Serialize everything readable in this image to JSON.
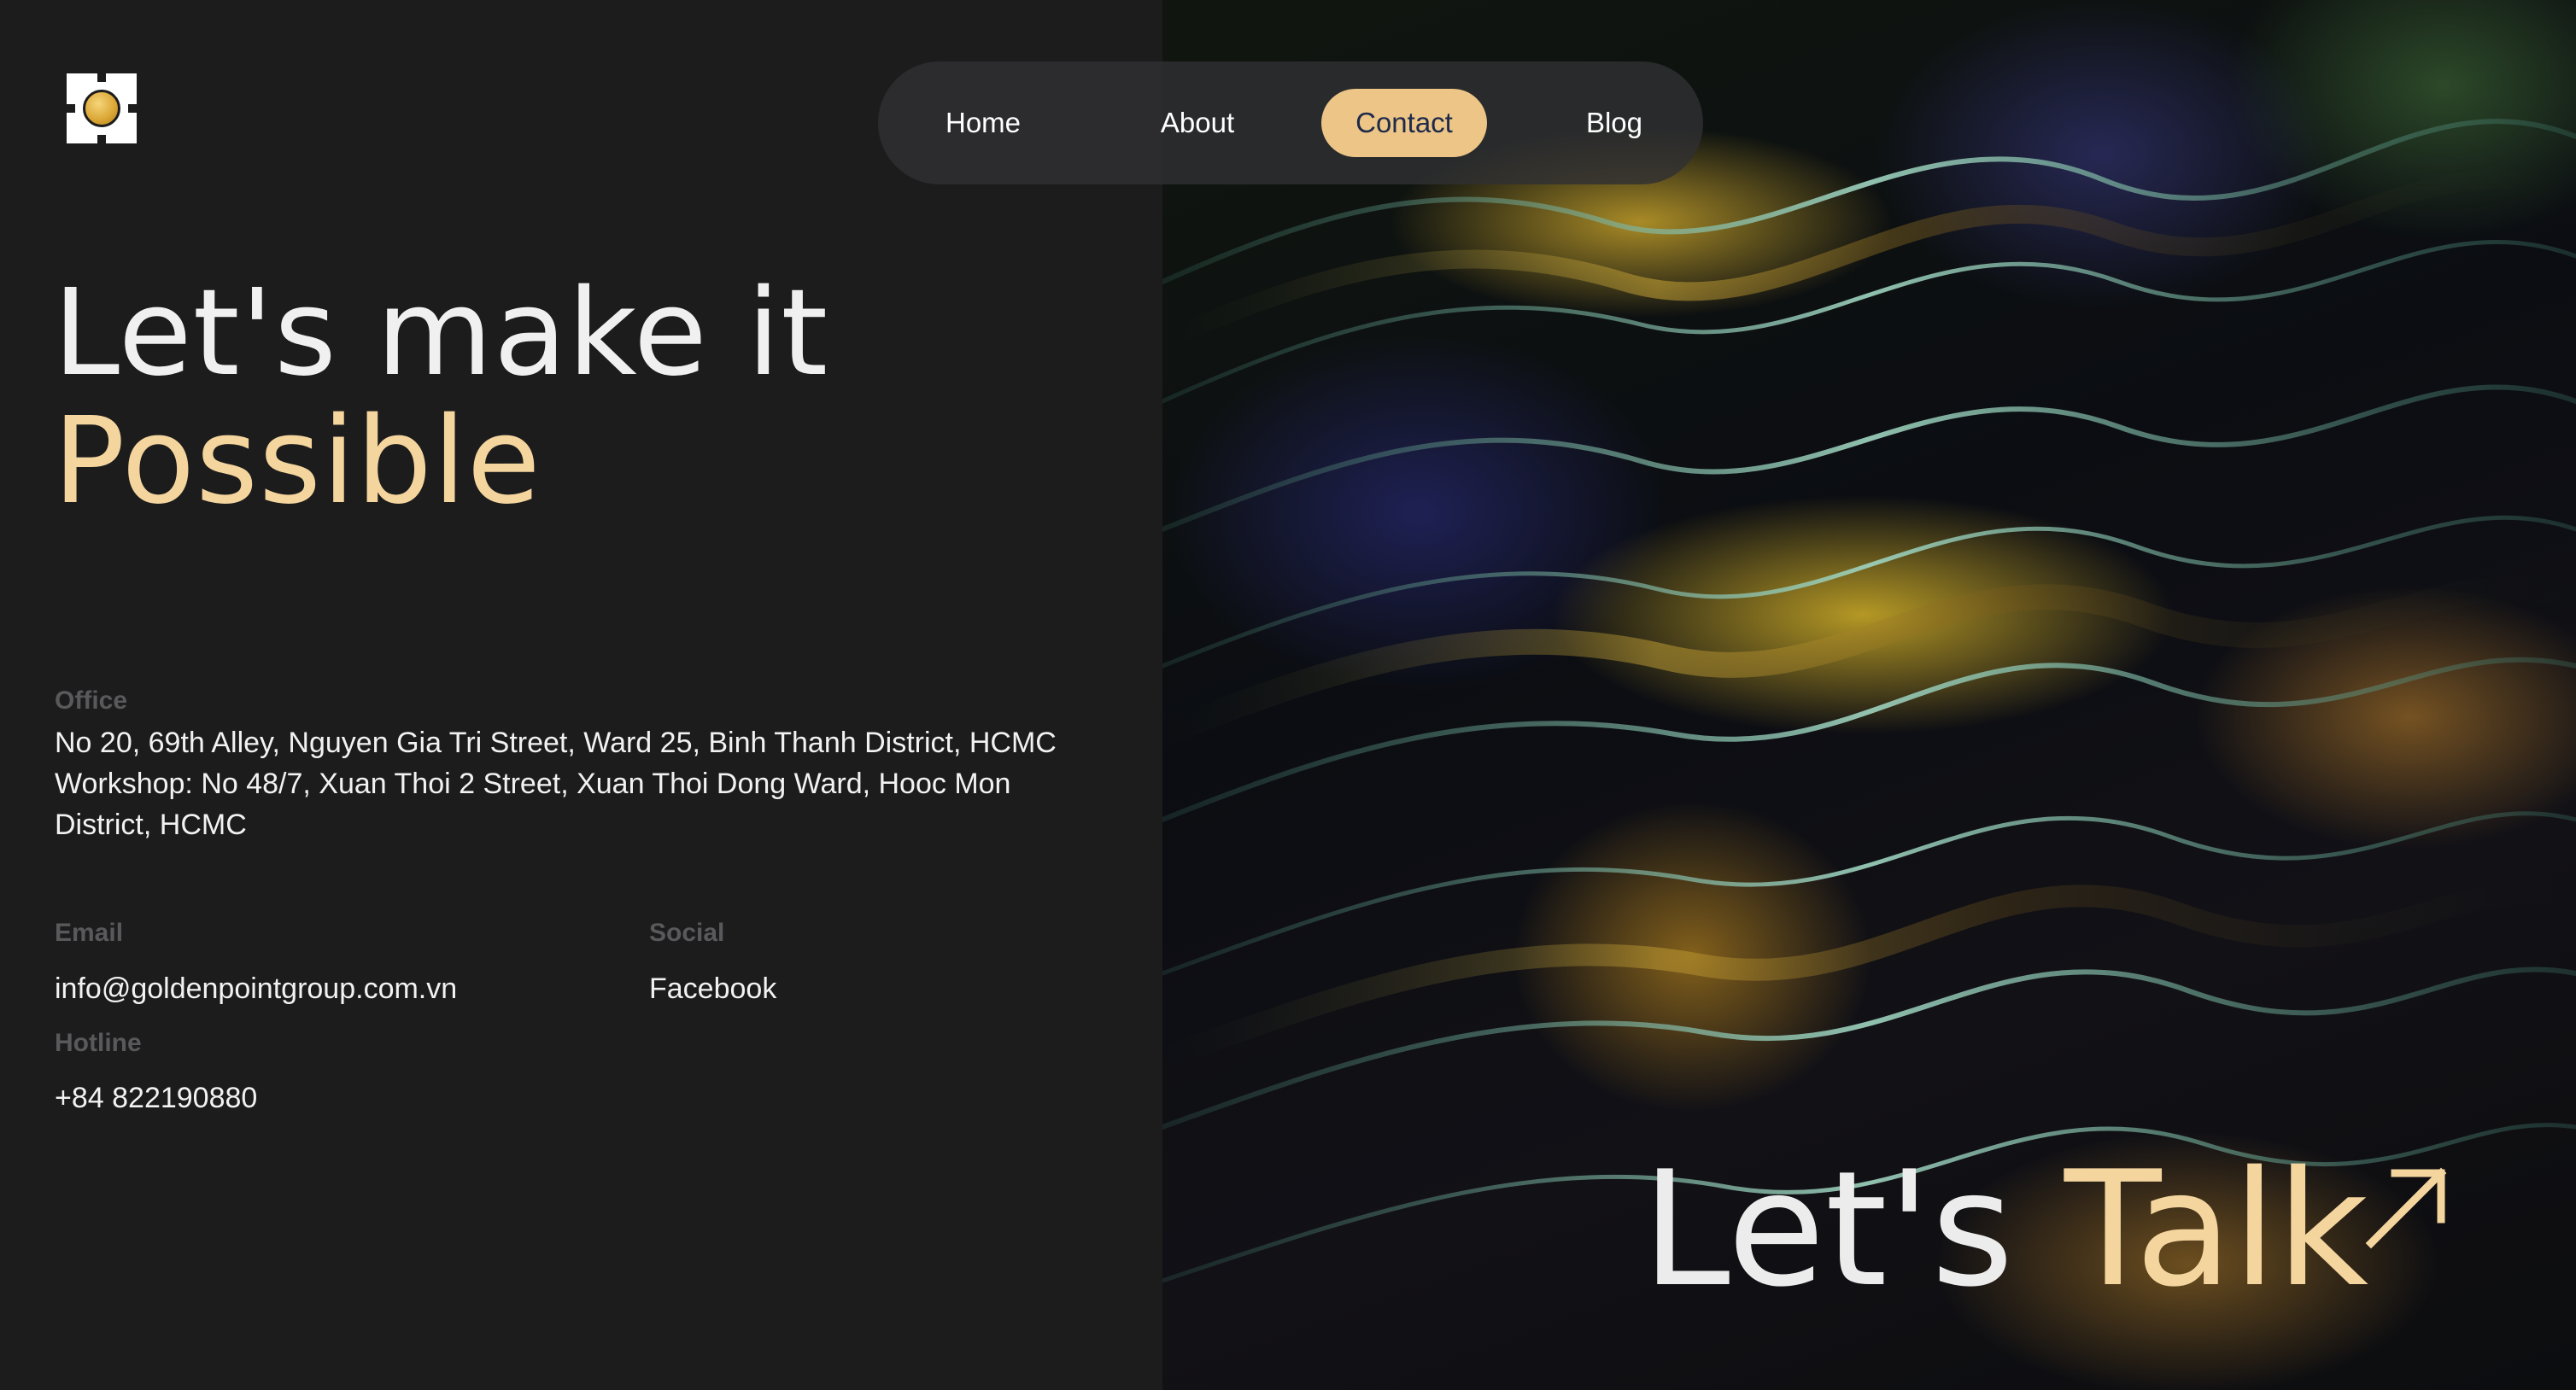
{
  "nav": {
    "items": [
      {
        "label": "Home"
      },
      {
        "label": "About"
      },
      {
        "label": "Contact",
        "active": true
      },
      {
        "label": "Blog"
      }
    ]
  },
  "headline": {
    "line1": "Let's make it",
    "line2": "Possible"
  },
  "office": {
    "label": "Office",
    "line1": "No 20, 69th Alley, Nguyen Gia Tri Street, Ward 25, Binh Thanh District, HCMC",
    "line2": "Workshop: No 48/7, Xuan Thoi 2 Street, Xuan Thoi Dong Ward, Hooc Mon District, HCMC"
  },
  "email": {
    "label": "Email",
    "value": "info@goldenpointgroup.com.vn"
  },
  "hotline": {
    "label": "Hotline",
    "value": "+84 822190880"
  },
  "social": {
    "label": "Social",
    "value": "Facebook"
  },
  "cta": {
    "word1": "Let's",
    "word2": "Talk",
    "icon": "arrow-up-right-icon"
  },
  "colors": {
    "background": "#1c1c1d",
    "accent": "#f5d59e",
    "nav_active_bg": "#ecc587",
    "nav_active_text": "#1e2a4a",
    "muted_label": "#59595b"
  }
}
